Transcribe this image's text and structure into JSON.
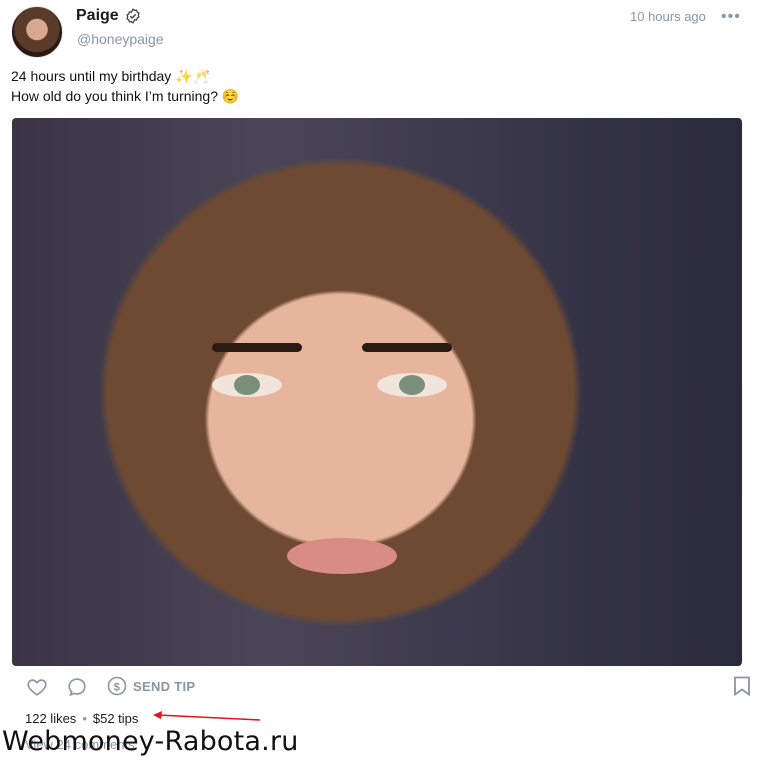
{
  "post": {
    "author_name": "Paige",
    "handle": "@honeypaige",
    "timestamp": "10 hours ago",
    "more_icon": "more-horizontal-icon",
    "text_line1": "24 hours until my birthday",
    "text_line1_emoji": "✨🥂",
    "text_line2": "How old do you think I’m turning?",
    "text_line2_emoji": "☺️",
    "likes": "122 likes",
    "tips": "$52 tips",
    "comments": "View 24 comments",
    "send_tip_label": "SEND TIP"
  },
  "icons": {
    "verified": "verified-check-icon",
    "like": "heart-icon",
    "comment": "comment-bubble-icon",
    "tip": "dollar-circle-icon",
    "bookmark": "bookmark-icon"
  },
  "watermark": "Webmoney-Rabota.ru",
  "colors": {
    "muted": "#8a96a3",
    "annotation_arrow": "#e0151b"
  }
}
